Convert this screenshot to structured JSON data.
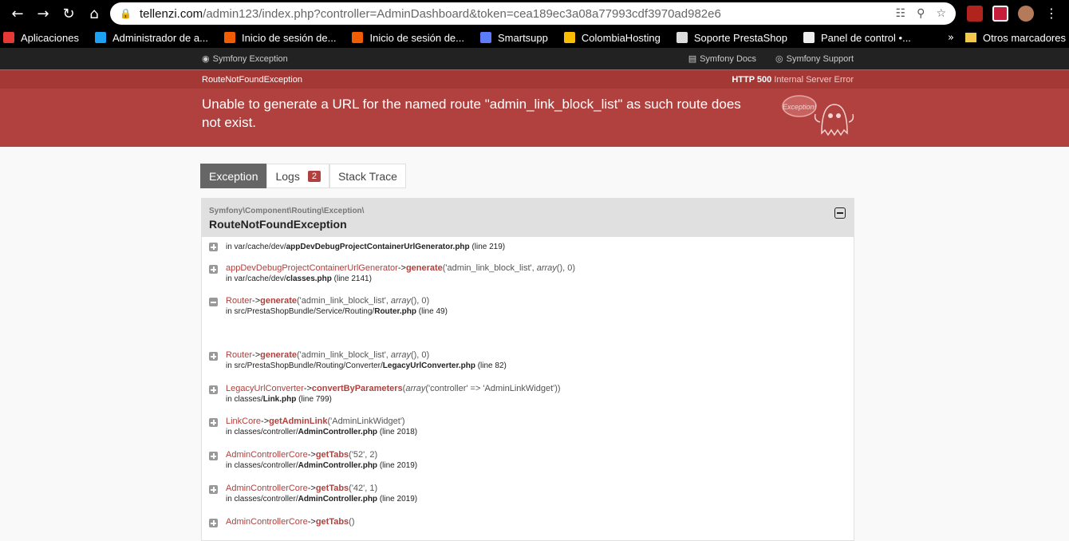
{
  "browser": {
    "url_host": "tellenzi.com",
    "url_rest": "/admin123/index.php?controller=AdminDashboard&token=cea189ec3a08a77993cdf3970ad982e6",
    "bookmarks": [
      {
        "label": "Aplicaciones",
        "color": "#e53935"
      },
      {
        "label": "Administrador de a...",
        "color": "#1da1f2"
      },
      {
        "label": "Inicio de sesión de...",
        "color": "#f25c05"
      },
      {
        "label": "Inicio de sesión de...",
        "color": "#f25c05"
      },
      {
        "label": "Smartsupp",
        "color": "#5c7cfa"
      },
      {
        "label": "ColombiaHosting",
        "color": "#fbbc04"
      },
      {
        "label": "Soporte PrestaShop",
        "color": "#ddd"
      },
      {
        "label": "Panel de control •...",
        "color": "#eee"
      }
    ],
    "more": "»",
    "other_bookmarks": "Otros marcadores"
  },
  "symfony": {
    "brand": "Symfony Exception",
    "docs": "Symfony Docs",
    "support": "Symfony Support"
  },
  "exception": {
    "class_short": "RouteNotFoundException",
    "status_code": "HTTP 500",
    "status_text": "Internal Server Error",
    "message": "Unable to generate a URL for the named route \"admin_link_block_list\" as such route does not exist.",
    "ghost_label": "Exception!"
  },
  "tabs": [
    {
      "label": "Exception"
    },
    {
      "label": "Logs",
      "badge": "2"
    },
    {
      "label": "Stack Trace"
    }
  ],
  "panel": {
    "namespace": "Symfony\\Component\\Routing\\Exception\\",
    "class": "RouteNotFoundException"
  },
  "trace": [
    {
      "icon": "plus",
      "file_prefix": "in var/cache/dev/",
      "file_name": "appDevDebugProjectContainerUrlGenerator.php",
      "line": "(line 219)"
    },
    {
      "icon": "plus",
      "class": "appDevDebugProjectContainerUrlGenerator",
      "arrow": "->",
      "fn": "generate",
      "args_pre": "('admin_link_block_list', ",
      "args_it": "array",
      "args_post": "(), 0)",
      "file_prefix": "in var/cache/dev/",
      "file_name": "classes.php",
      "line": "(line 2141)"
    },
    {
      "icon": "minus",
      "class": "Router",
      "arrow": "->",
      "fn": "generate",
      "args_pre": "('admin_link_block_list', ",
      "args_it": "array",
      "args_post": "(), 0)",
      "file_prefix": "in src/PrestaShopBundle/Service/Routing/",
      "file_name": "Router.php",
      "line": "(line 49)"
    },
    {
      "icon": "plus",
      "class": "Router",
      "arrow": "->",
      "fn": "generate",
      "args_pre": "('admin_link_block_list', ",
      "args_it": "array",
      "args_post": "(), 0)",
      "file_prefix": "in src/PrestaShopBundle/Routing/Converter/",
      "file_name": "LegacyUrlConverter.php",
      "line": "(line 82)"
    },
    {
      "icon": "plus",
      "class": "LegacyUrlConverter",
      "arrow": "->",
      "fn": "convertByParameters",
      "args_pre": "(",
      "args_it": "array",
      "args_post": "('controller' => 'AdminLinkWidget'))",
      "file_prefix": "in classes/",
      "file_name": "Link.php",
      "line": "(line 799)"
    },
    {
      "icon": "plus",
      "class": "LinkCore",
      "arrow": "->",
      "fn": "getAdminLink",
      "args_pre": "('AdminLinkWidget')",
      "args_it": "",
      "args_post": "",
      "file_prefix": "in classes/controller/",
      "file_name": "AdminController.php",
      "line": "(line 2018)"
    },
    {
      "icon": "plus",
      "class": "AdminControllerCore",
      "arrow": "->",
      "fn": "getTabs",
      "args_pre": "('52', 2)",
      "args_it": "",
      "args_post": "",
      "file_prefix": "in classes/controller/",
      "file_name": "AdminController.php",
      "line": "(line 2019)"
    },
    {
      "icon": "plus",
      "class": "AdminControllerCore",
      "arrow": "->",
      "fn": "getTabs",
      "args_pre": "('42', 1)",
      "args_it": "",
      "args_post": "",
      "file_prefix": "in classes/controller/",
      "file_name": "AdminController.php",
      "line": "(line 2019)"
    },
    {
      "icon": "plus",
      "class": "AdminControllerCore",
      "arrow": "->",
      "fn": "getTabs",
      "args_pre": "()",
      "args_it": "",
      "args_post": ""
    }
  ]
}
